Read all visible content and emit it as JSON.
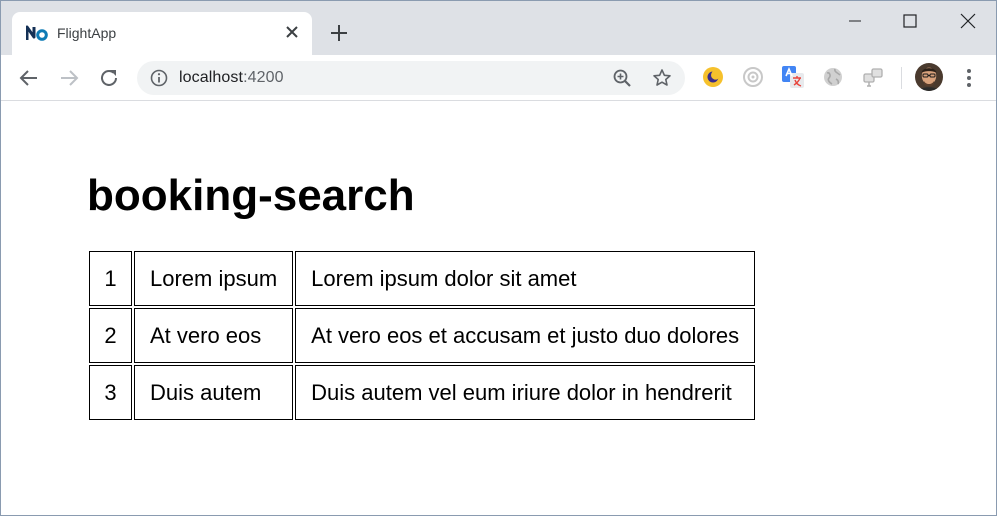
{
  "browser": {
    "tab": {
      "title": "FlightApp",
      "favicon": "nx-logo-icon",
      "close_icon": "close-icon"
    },
    "new_tab_icon": "plus-icon",
    "window_controls": [
      "minimize-icon",
      "maximize-icon",
      "close-window-icon"
    ],
    "nav": [
      "back-arrow-icon",
      "forward-arrow-icon",
      "reload-icon"
    ],
    "address": {
      "host": "localhost",
      "port": ":4200"
    },
    "omnibox_icons": [
      "info-icon",
      "zoom-icon",
      "star-icon"
    ],
    "extensions": [
      "moon-extension-icon",
      "target-extension-icon",
      "translate-extension-icon",
      "globe-extension-icon",
      "network-extension-icon"
    ],
    "colors": {
      "tabstrip": "#dee1e6",
      "omnibox": "#f1f3f4",
      "accent": "#1a73e8"
    }
  },
  "page": {
    "title": "booking-search",
    "rows": [
      {
        "id": "1",
        "name": "Lorem ipsum",
        "description": "Lorem ipsum dolor sit amet"
      },
      {
        "id": "2",
        "name": "At vero eos",
        "description": "At vero eos et accusam et justo duo dolores"
      },
      {
        "id": "3",
        "name": "Duis autem",
        "description": "Duis autem vel eum iriure dolor in hendrerit"
      }
    ]
  }
}
